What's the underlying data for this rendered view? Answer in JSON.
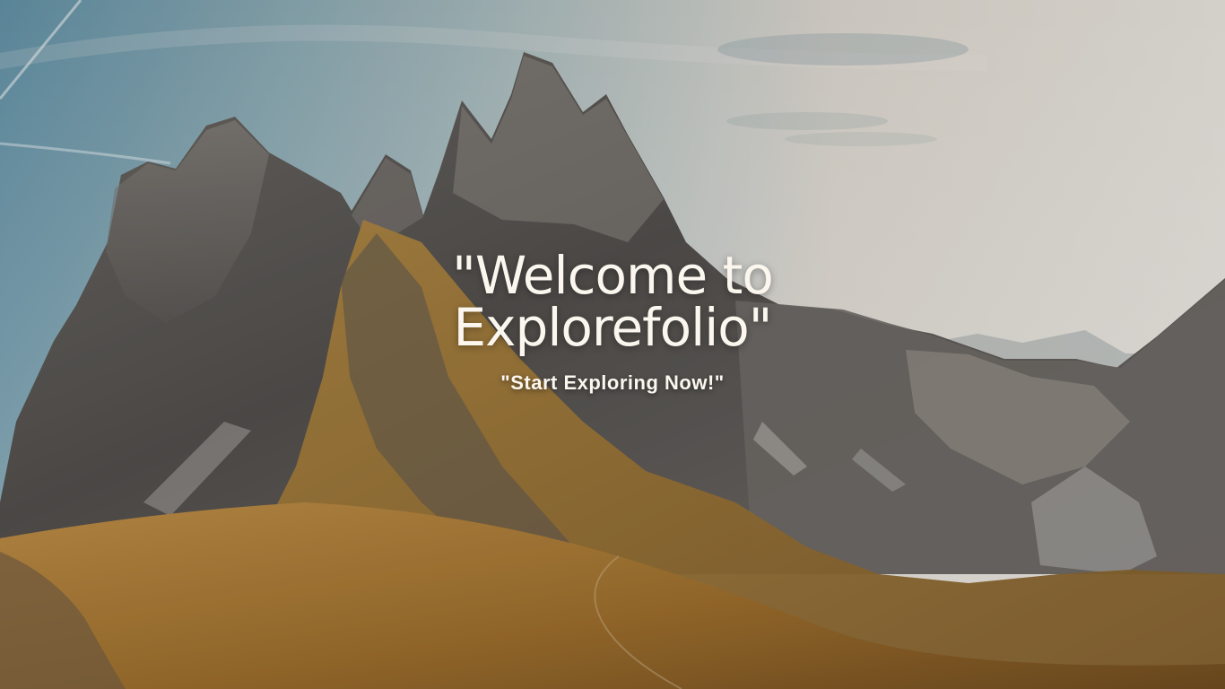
{
  "hero": {
    "title": "\"Welcome to Explorefolio\"",
    "subtitle": "\"Start Exploring Now!\"",
    "background_image": "mountain-landscape-image"
  },
  "colors": {
    "text": "#fbf6ee",
    "sky": "#d7d3cb",
    "rock": "#5f5b58",
    "meadow": "#a7782b"
  }
}
